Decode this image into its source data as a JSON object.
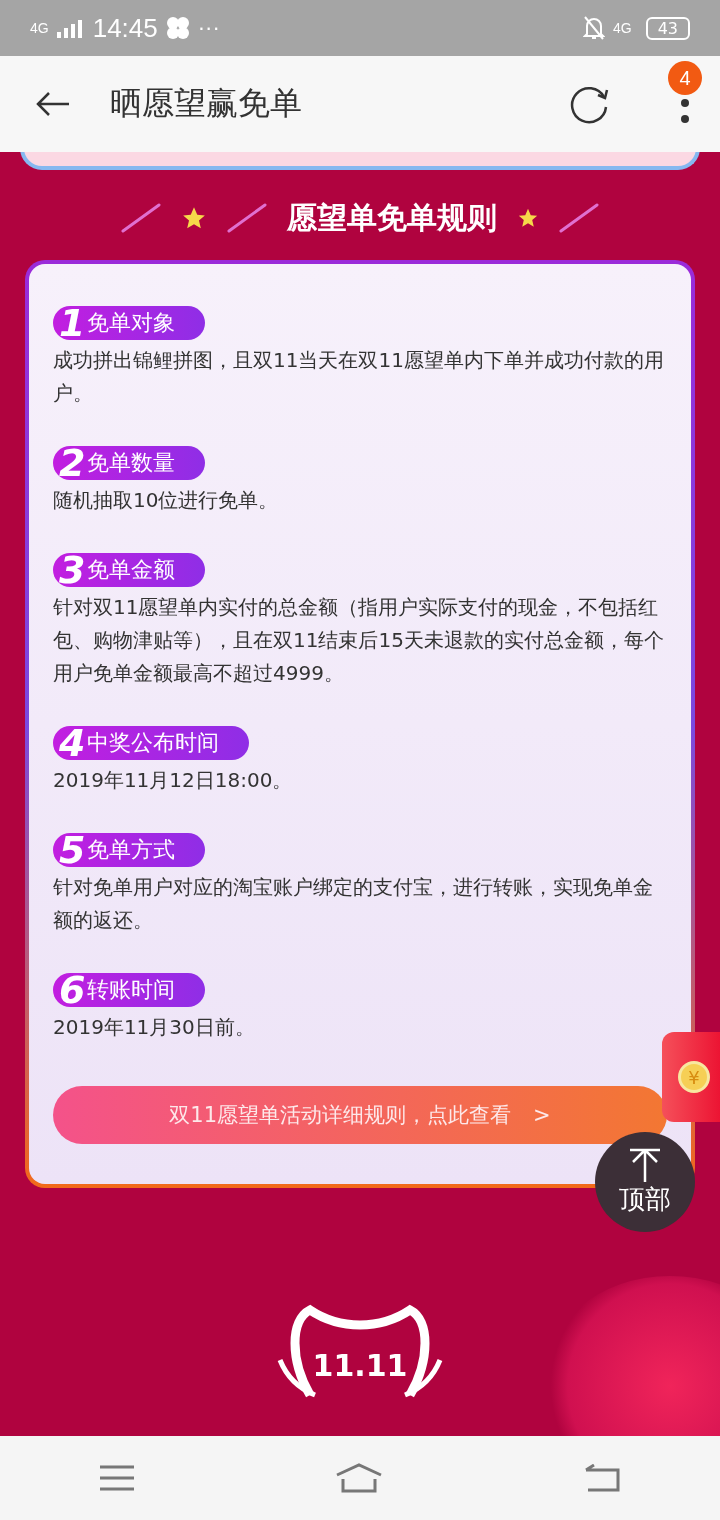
{
  "status_bar": {
    "network": "4G",
    "time": "14:45",
    "more": "···",
    "network_right": "4G",
    "battery": "43"
  },
  "header": {
    "title": "晒愿望赢免单",
    "menu_badge": "4"
  },
  "section_title": "愿望单免单规则",
  "rules": [
    {
      "number": "1",
      "label": "免单对象",
      "text": "成功拼出锦鲤拼图，且双11当天在双11愿望单内下单并成功付款的用户。"
    },
    {
      "number": "2",
      "label": "免单数量",
      "text": "随机抽取10位进行免单。"
    },
    {
      "number": "3",
      "label": "免单金额",
      "text": "针对双11愿望单内实付的总金额（指用户实际支付的现金，不包括红包、购物津贴等），且在双11结束后15天未退款的实付总金额，每个用户免单金额最高不超过4999。"
    },
    {
      "number": "4",
      "label": "中奖公布时间",
      "text": "2019年11月12日18:00。"
    },
    {
      "number": "5",
      "label": "免单方式",
      "text": "针对免单用户对应的淘宝账户绑定的支付宝，进行转账，实现免单金额的返还。"
    },
    {
      "number": "6",
      "label": "转账时间",
      "text": "2019年11月30日前。"
    }
  ],
  "details_button": {
    "label": "双11愿望单活动详细规则，点此查看",
    "arrow": ">"
  },
  "red_envelope": {
    "symbol": "¥"
  },
  "back_to_top": {
    "label": "顶部"
  },
  "logo": {
    "text": "11.11"
  }
}
